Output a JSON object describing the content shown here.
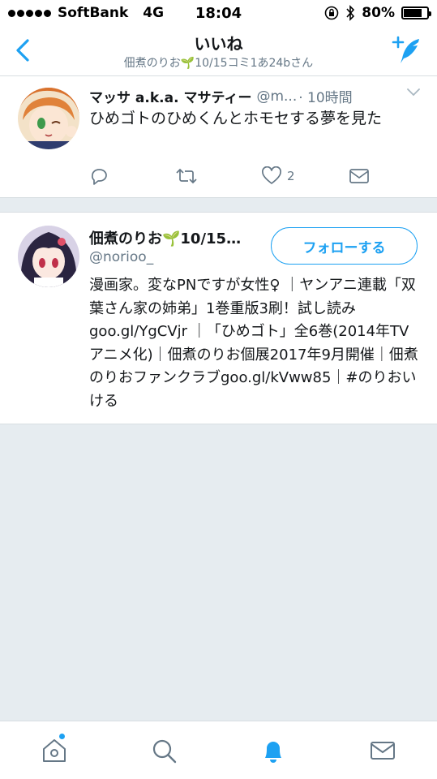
{
  "status": {
    "carrier": "SoftBank",
    "network": "4G",
    "time": "18:04",
    "battery_percent": "80%",
    "battery_level": 0.8
  },
  "nav": {
    "title": "いいね",
    "subtitle": "佃煮のりお🌱10/15コミ1あ24bさん"
  },
  "tweet": {
    "author_name": "マッサ a.k.a. マサティー",
    "author_handle": "@m...",
    "time": "· 10時間",
    "text": "ひめゴトのひめくんとホモセする夢を見た",
    "like_count": "2"
  },
  "user": {
    "name": "佃煮のりお🌱10/15…",
    "handle": "@norioo_",
    "follow_label": "フォローする",
    "bio": "漫画家。変なPNですが女性♀ ｜ヤンアニ連載「双葉さん家の姉弟」1巻重版3刷！試し読みgoo.gl/YgCVjr ｜「ひめゴト」全6巻(2014年TVアニメ化)｜佃煮のりお個展2017年9月開催｜佃煮のりおファンクラブgoo.gl/kVww85｜#のりおいける"
  },
  "tabs": [
    {
      "name": "home-icon"
    },
    {
      "name": "search-icon"
    },
    {
      "name": "notifications-icon"
    },
    {
      "name": "messages-icon"
    }
  ],
  "colors": {
    "accent": "#1da1f2",
    "muted": "#657786",
    "background": "#e6ecf0"
  }
}
